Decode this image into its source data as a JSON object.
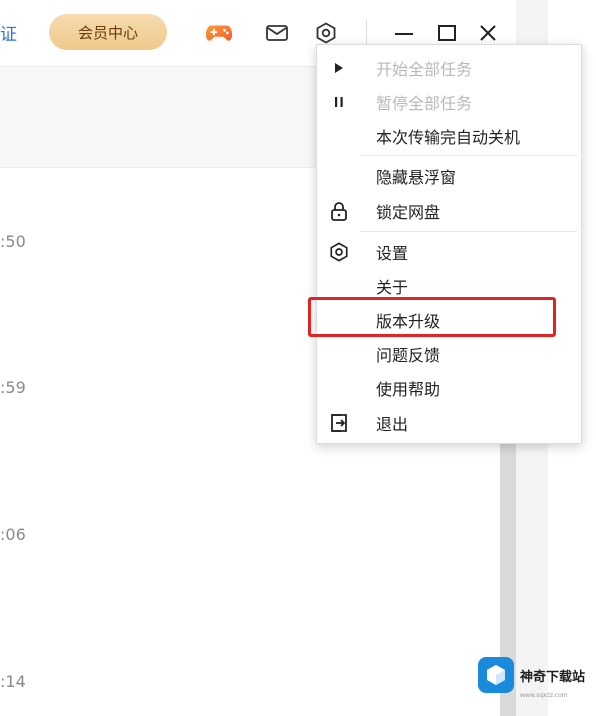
{
  "topbar": {
    "left_text": "证",
    "vip_label": "会员中心",
    "icons": [
      "gamepad-icon",
      "mail-icon",
      "settings-icon",
      "minimize-icon",
      "maximize-icon",
      "close-icon"
    ]
  },
  "list": {
    "times": [
      ":50",
      ":59",
      ":06",
      ":14"
    ]
  },
  "menu": {
    "items": [
      {
        "label": "开始全部任务",
        "disabled": true,
        "icon": "play-icon"
      },
      {
        "label": "暂停全部任务",
        "disabled": true,
        "icon": "pause-icon"
      },
      {
        "label": "本次传输完自动关机",
        "disabled": false,
        "icon": ""
      },
      {
        "label": "隐藏悬浮窗",
        "disabled": false,
        "icon": ""
      },
      {
        "label": "锁定网盘",
        "disabled": false,
        "icon": "lock-icon"
      },
      {
        "label": "设置",
        "disabled": false,
        "icon": "settings-icon"
      },
      {
        "label": "关于",
        "disabled": false,
        "icon": ""
      },
      {
        "label": "版本升级",
        "disabled": false,
        "icon": "",
        "highlighted": true
      },
      {
        "label": "问题反馈",
        "disabled": false,
        "icon": ""
      },
      {
        "label": "使用帮助",
        "disabled": false,
        "icon": ""
      },
      {
        "label": "退出",
        "disabled": false,
        "icon": "exit-icon"
      }
    ]
  },
  "watermark": {
    "text": "神奇下载站",
    "sub": "www.sqxzz.com"
  },
  "colors": {
    "vip_bg": "#efc98c",
    "highlight": "#e02424",
    "accent": "#2f6fe4"
  }
}
